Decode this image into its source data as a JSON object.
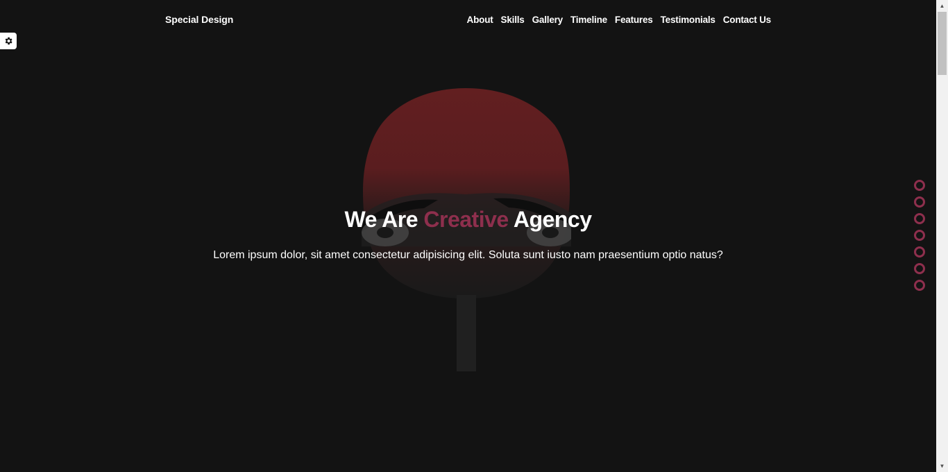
{
  "header": {
    "logo": "Special Design",
    "nav": [
      "About",
      "Skills",
      "Gallery",
      "Timeline",
      "Features",
      "Testimonials",
      "Contact Us"
    ]
  },
  "hero": {
    "title_before": "We Are ",
    "title_accent": "Creative",
    "title_after": " Agency",
    "description": "Lorem ipsum dolor, sit amet consectetur adipisicing elit. Soluta sunt iusto nam praesentium optio natus?"
  },
  "bullets_count": 7,
  "colors": {
    "background": "#131313",
    "accent": "#8e2f4d",
    "text": "#ffffff"
  },
  "icons": {
    "settings": "gear-icon",
    "bullets": "circle-outline-icon"
  }
}
